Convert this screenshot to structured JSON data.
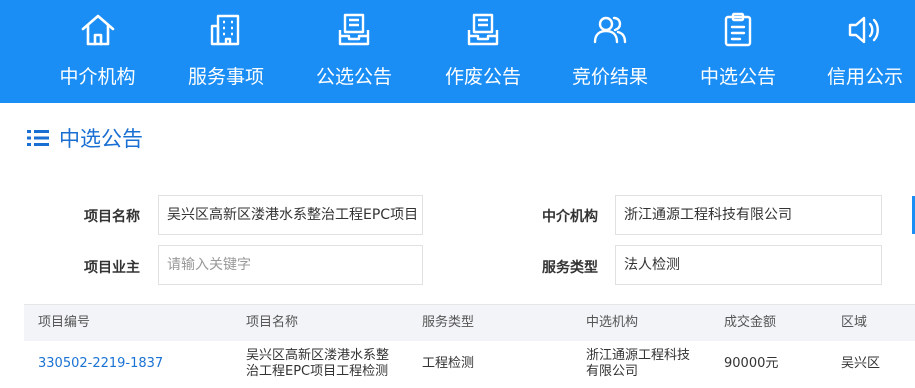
{
  "nav": {
    "items": [
      {
        "label": "中介机构",
        "icon": "house-icon"
      },
      {
        "label": "服务事项",
        "icon": "building-icon"
      },
      {
        "label": "公选公告",
        "icon": "document-tray-icon"
      },
      {
        "label": "作废公告",
        "icon": "document-tray-icon"
      },
      {
        "label": "竞价结果",
        "icon": "users-icon"
      },
      {
        "label": "中选公告",
        "icon": "clipboard-icon"
      },
      {
        "label": "信用公示",
        "icon": "speaker-icon"
      }
    ]
  },
  "page": {
    "title": "中选公告"
  },
  "filters": {
    "project_name": {
      "label": "项目名称",
      "value": "吴兴区高新区溇港水系整治工程EPC项目"
    },
    "agency": {
      "label": "中介机构",
      "value": "浙江通源工程科技有限公司"
    },
    "owner": {
      "label": "项目业主",
      "placeholder": "请输入关键字"
    },
    "service_type": {
      "label": "服务类型",
      "value": "法人检测"
    }
  },
  "table": {
    "headers": [
      "项目编号",
      "项目名称",
      "服务类型",
      "中选机构",
      "成交金额",
      "区域"
    ],
    "rows": [
      {
        "code": "330502-2219-1837",
        "name_line1": "吴兴区高新区溇港水系整",
        "name_line2": "治工程EPC项目工程检测",
        "service": "工程检测",
        "org_line1": "浙江通源工程科技",
        "org_line2": "有限公司",
        "amount": "90000元",
        "region": "吴兴区"
      }
    ]
  },
  "colors": {
    "nav_bg": "#1a8ef5",
    "accent": "#1a6fd2",
    "link": "#1a72d4"
  }
}
